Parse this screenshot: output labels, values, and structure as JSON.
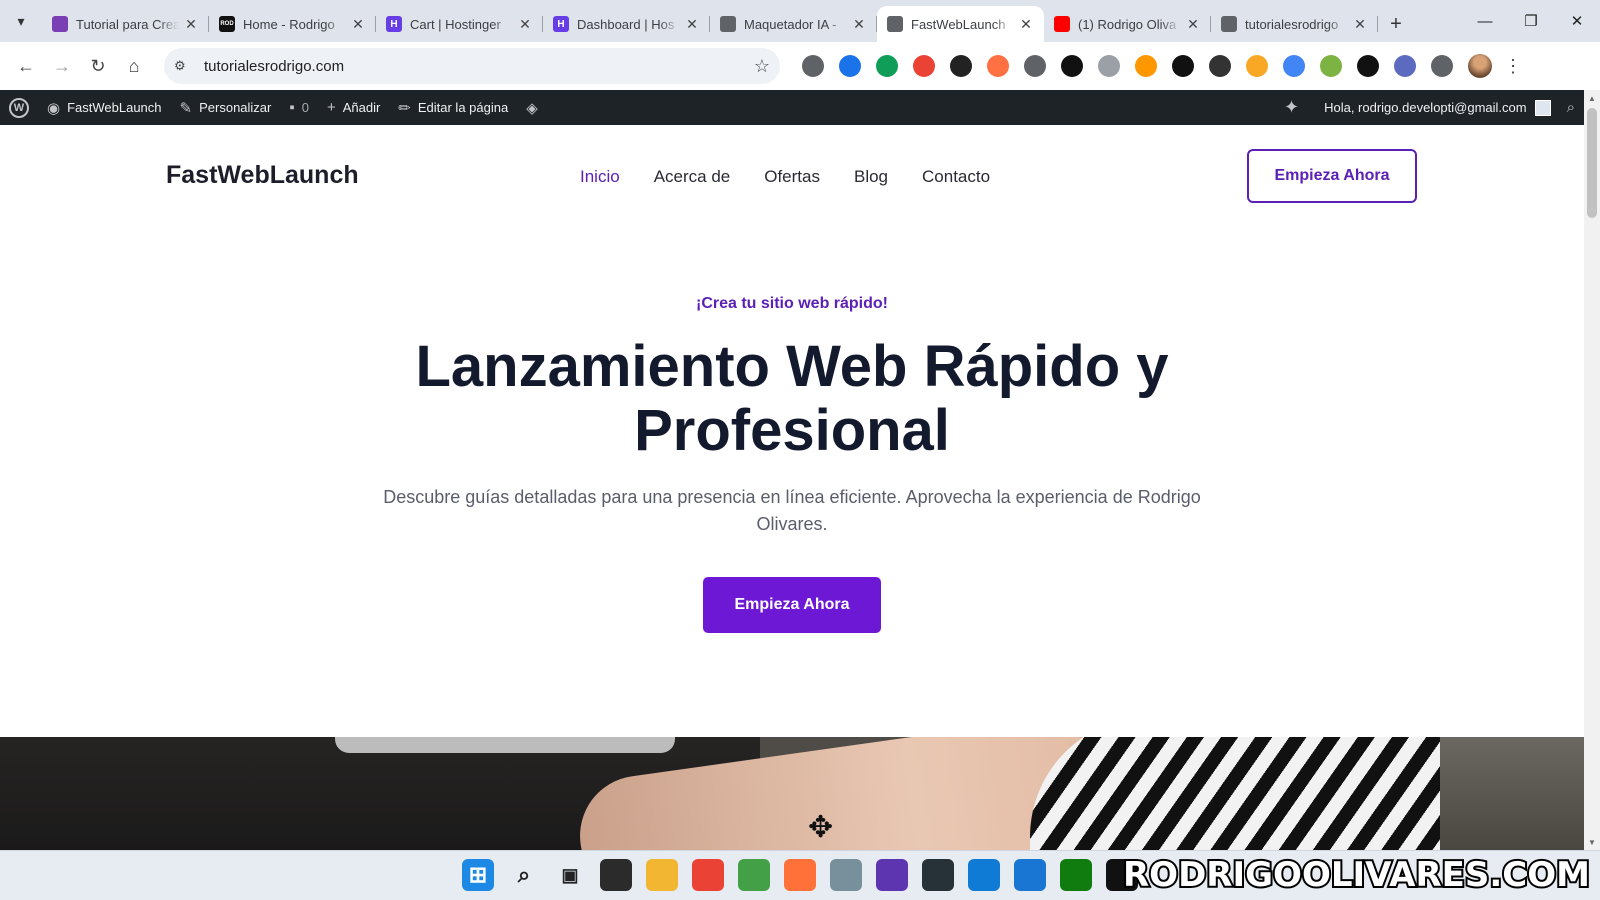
{
  "browser": {
    "tabs": [
      {
        "title": "Tutorial para Crea",
        "favicon_color": "#7b3fb5",
        "active": false
      },
      {
        "title": "Home - Rodrigo",
        "favicon_color": "#111111",
        "favicon_text": "ROD",
        "active": false
      },
      {
        "title": "Cart | Hostinger",
        "favicon_color": "#673de6",
        "favicon_text": "H",
        "active": false
      },
      {
        "title": "Dashboard | Hos",
        "favicon_color": "#673de6",
        "favicon_text": "H",
        "active": false
      },
      {
        "title": "Maquetador IA -",
        "favicon_color": "#5f6368",
        "active": false
      },
      {
        "title": "FastWebLaunch",
        "favicon_color": "#5f6368",
        "active": true
      },
      {
        "title": "(1) Rodrigo Oliva",
        "favicon_color": "#ff0000",
        "active": false
      },
      {
        "title": "tutorialesrodrigo",
        "favicon_color": "#5f6368",
        "active": false
      }
    ],
    "new_tab_label": "+",
    "url": "tutorialesrodrigo.com",
    "extensions": [
      "#5f6368",
      "#1a73e8",
      "#0f9d58",
      "#ea4335",
      "#222222",
      "#ff7043",
      "#5f6368",
      "#111111",
      "#9aa0a6",
      "#ff9800",
      "#111111",
      "#333333",
      "#f9a825",
      "#4285f4",
      "#7cb342",
      "#111111",
      "#5c6bc0",
      "#5f6368"
    ],
    "icons": {
      "tab_dropdown": "▾",
      "back": "←",
      "forward": "→",
      "reload": "↻",
      "home": "⌂",
      "site_info": "⚙",
      "star": "☆",
      "menu": "⋮",
      "minimize": "—",
      "restore": "❐",
      "close": "✕"
    }
  },
  "wpbar": {
    "site_name": "FastWebLaunch",
    "customize": "Personalizar",
    "comments_count": "0",
    "add_new": "Añadir",
    "edit_page": "Editar la página",
    "greeting": "Hola, rodrigo.developti@gmail.com"
  },
  "site": {
    "logo": "FastWebLaunch",
    "menu": [
      {
        "label": "Inicio",
        "active": true
      },
      {
        "label": "Acerca de",
        "active": false
      },
      {
        "label": "Ofertas",
        "active": false
      },
      {
        "label": "Blog",
        "active": false
      },
      {
        "label": "Contacto",
        "active": false
      }
    ],
    "header_cta": "Empieza Ahora",
    "accent_color": "#5b21b6"
  },
  "hero": {
    "eyebrow": "¡Crea tu sitio web rápido!",
    "headline": "Lanzamiento Web Rápido y Profesional",
    "lead": "Descubre guías detalladas para una presencia en línea eficiente. Aprovecha la experiencia de Rodrigo Olivares.",
    "cta": "Empieza Ahora",
    "cta_color": "#6d18d4"
  },
  "taskbar": {
    "icons": [
      {
        "name": "windows-start-icon",
        "color": "#1e88e5"
      },
      {
        "name": "search-icon",
        "color": "#e7ecf3"
      },
      {
        "name": "task-view-icon",
        "color": "#e7ecf3"
      },
      {
        "name": "obs-icon",
        "color": "#2b2b2b"
      },
      {
        "name": "file-explorer-icon",
        "color": "#f2b632"
      },
      {
        "name": "chrome-icon",
        "color": "#ea4335"
      },
      {
        "name": "image-app-icon",
        "color": "#43a047"
      },
      {
        "name": "firefox-icon",
        "color": "#ff7139"
      },
      {
        "name": "settings-icon",
        "color": "#78909c"
      },
      {
        "name": "headphones-icon",
        "color": "#5e35b1"
      },
      {
        "name": "terminal-icon",
        "color": "#263238"
      },
      {
        "name": "edge-icon",
        "color": "#0f7bd4"
      },
      {
        "name": "notepad-icon",
        "color": "#1976d2"
      },
      {
        "name": "xbox-icon",
        "color": "#107c10"
      },
      {
        "name": "capcut-icon",
        "color": "#111111"
      }
    ]
  },
  "watermark": "RODRIGOOLIVARES.COM"
}
